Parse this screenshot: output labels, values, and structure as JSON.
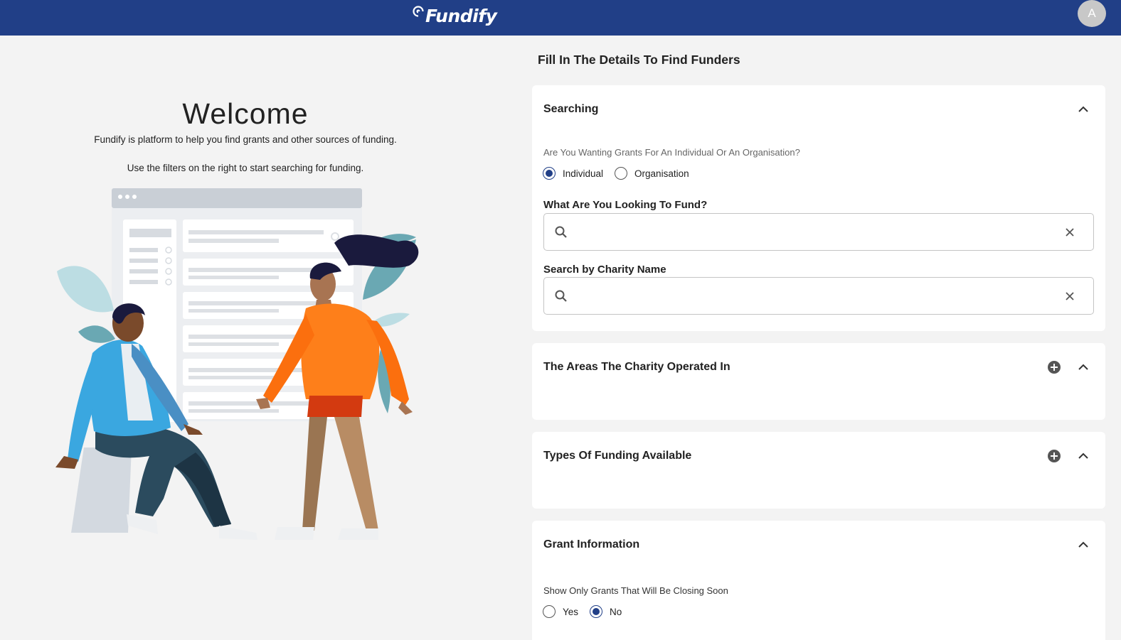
{
  "header": {
    "logo_text": "Fundify",
    "avatar_initial": "A",
    "brand_color": "#213f87"
  },
  "welcome": {
    "title": "Welcome",
    "line1": "Fundify is platform to help you find grants and other sources of funding.",
    "line2": "Use the filters on the right to start searching for funding."
  },
  "form": {
    "title": "Fill In The Details To Find Funders",
    "searching": {
      "title": "Searching",
      "question": "Are You Wanting Grants For An Individual Or An Organisation?",
      "options": [
        {
          "label": "Individual",
          "checked": true
        },
        {
          "label": "Organisation",
          "checked": false
        }
      ],
      "fund_label": "What Are You Looking To Fund?",
      "fund_value": "",
      "charity_label": "Search by Charity Name",
      "charity_value": ""
    },
    "areas": {
      "title": "The Areas The Charity Operated In"
    },
    "funding_types": {
      "title": "Types Of Funding Available"
    },
    "grant_info": {
      "title": "Grant Information",
      "question": "Show Only Grants That Will Be Closing Soon",
      "options": [
        {
          "label": "Yes",
          "checked": false
        },
        {
          "label": "No",
          "checked": true
        }
      ]
    }
  }
}
